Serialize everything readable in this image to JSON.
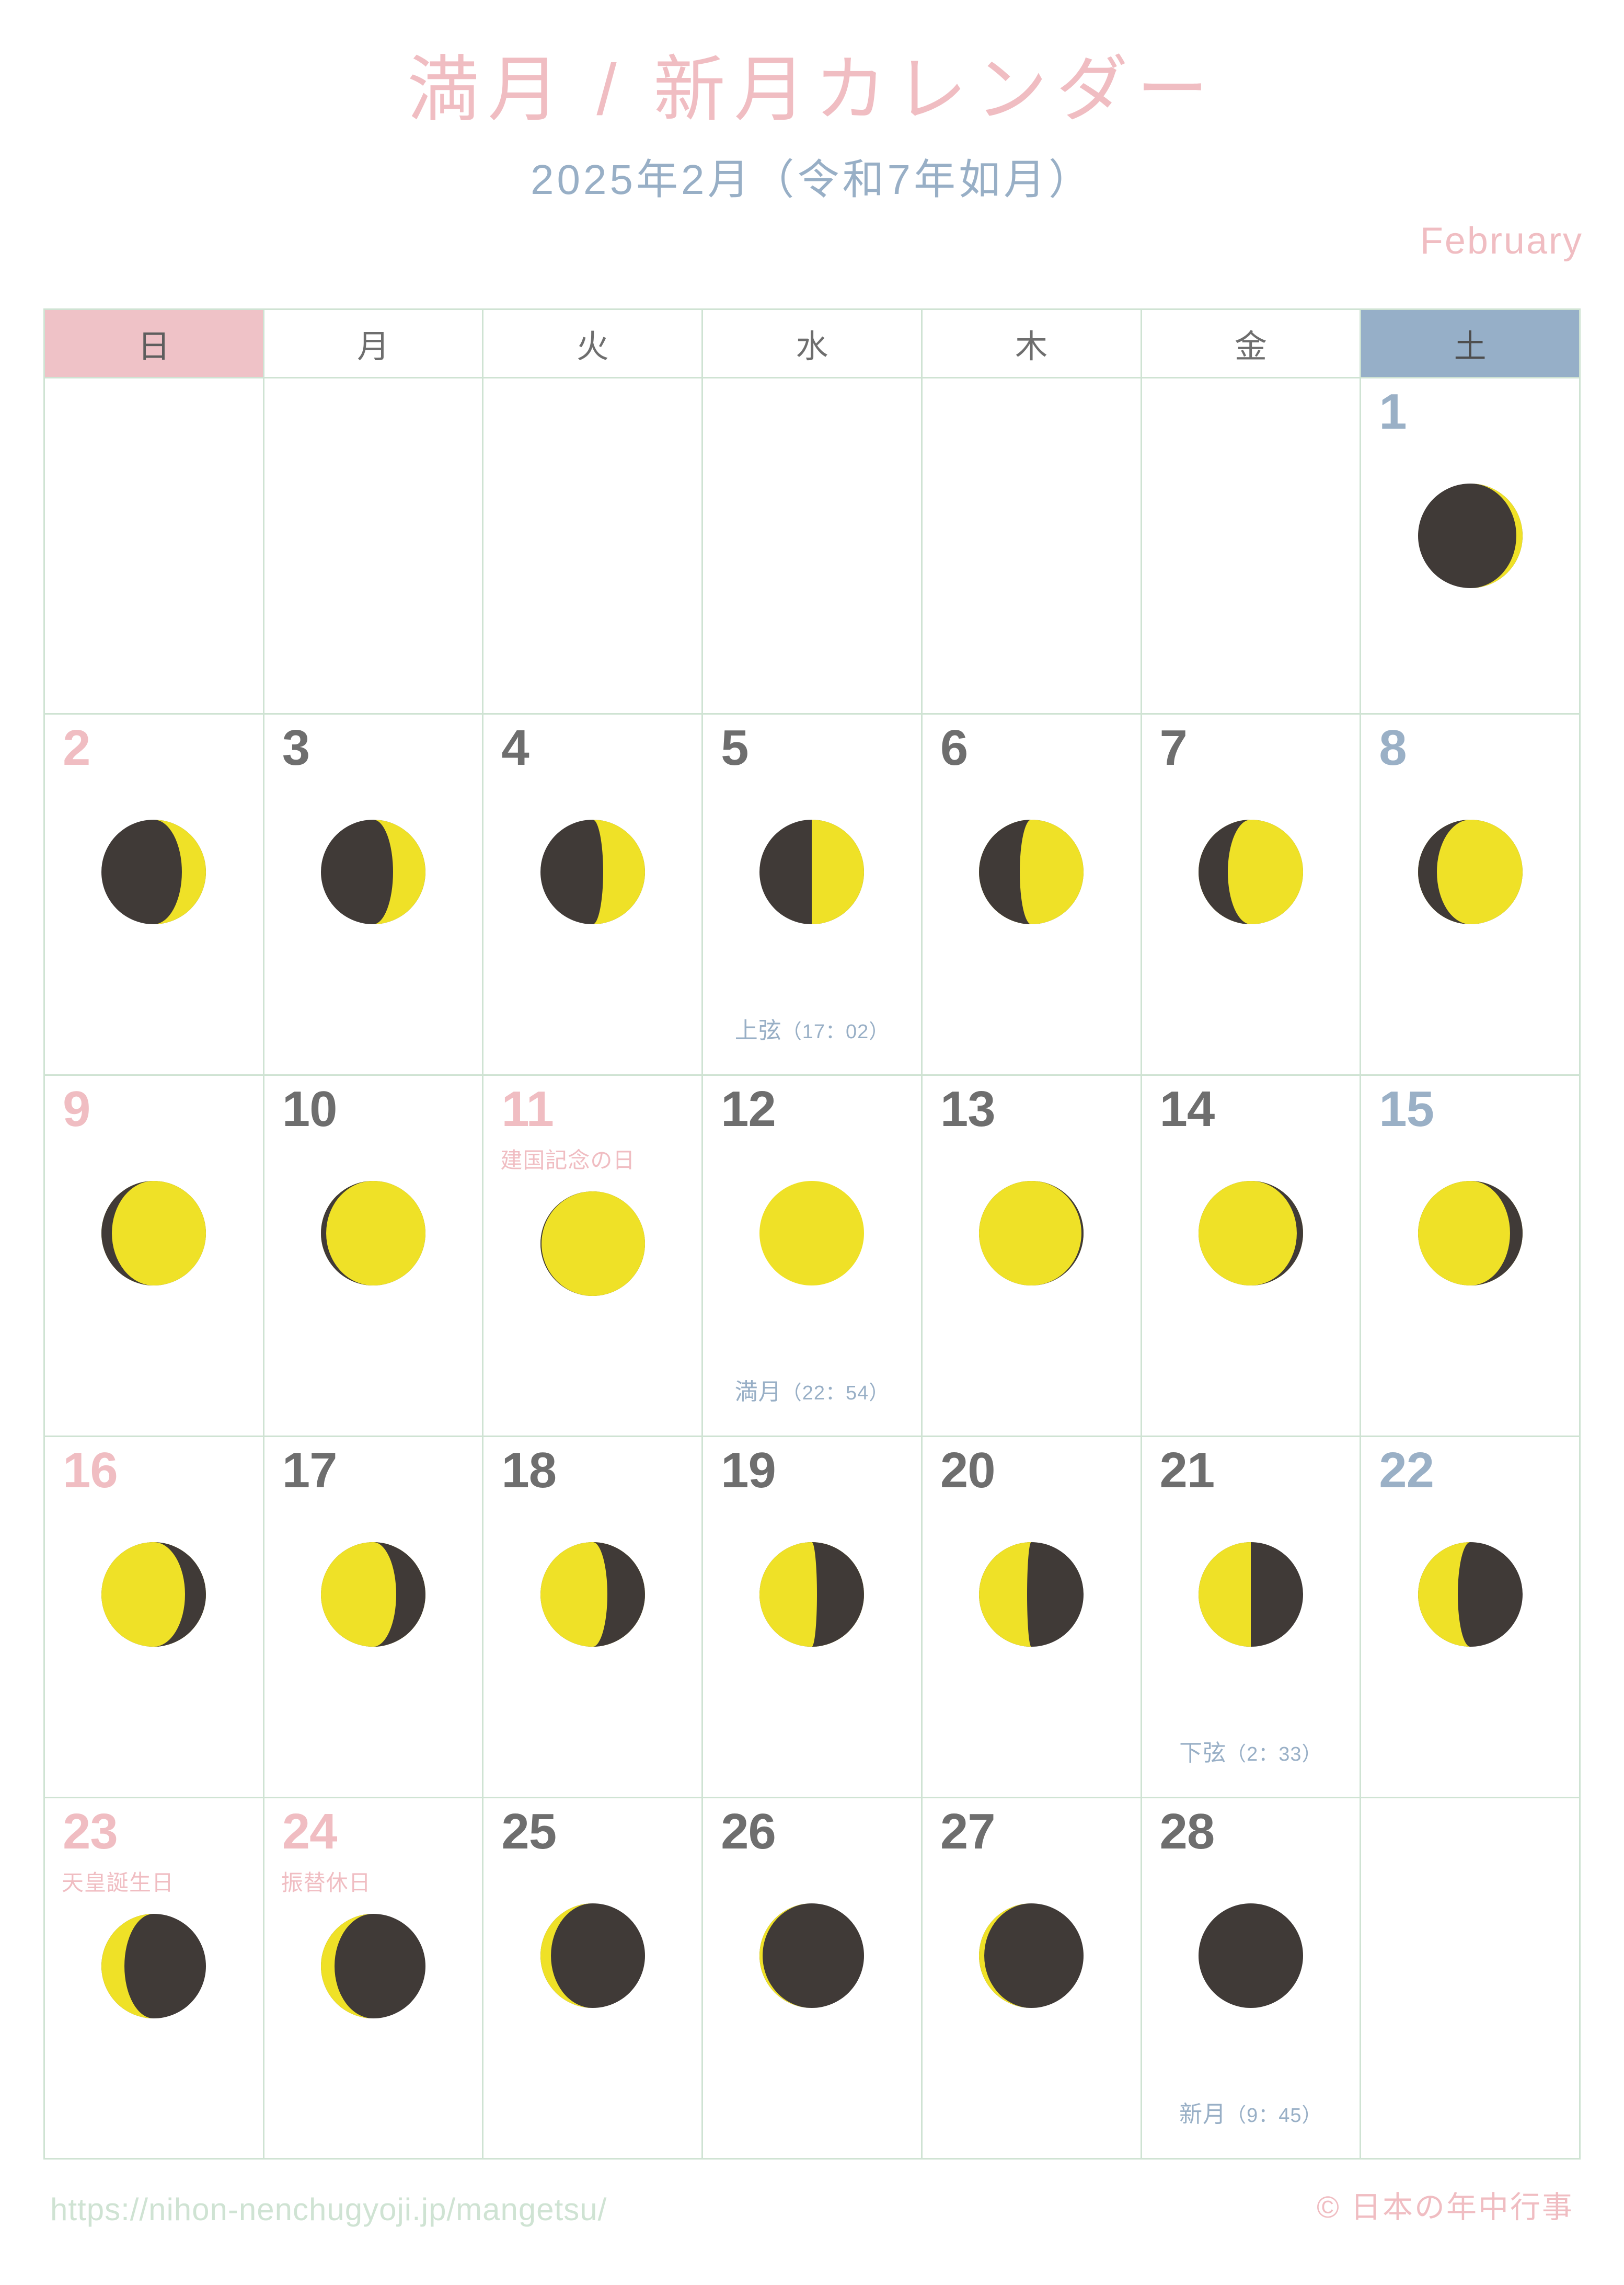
{
  "header": {
    "title": "満月 / 新月カレンダー",
    "subtitle": "2025年2月（令和7年如月）",
    "month_en": "February"
  },
  "weekdays": [
    {
      "label": "日",
      "kind": "sun"
    },
    {
      "label": "月",
      "kind": "weekday"
    },
    {
      "label": "火",
      "kind": "weekday"
    },
    {
      "label": "水",
      "kind": "weekday"
    },
    {
      "label": "木",
      "kind": "weekday"
    },
    {
      "label": "金",
      "kind": "weekday"
    },
    {
      "label": "土",
      "kind": "sat"
    }
  ],
  "colors": {
    "pink": "#F0BDC2",
    "blue": "#98AFC6",
    "grid_green": "#CFE3D3",
    "moon_dark": "#403A37",
    "moon_light": "#EFE127",
    "gray_text": "#6E6E6E"
  },
  "days": [
    {
      "n": "1",
      "col": 6,
      "kind": "sat",
      "illum": 0.06,
      "dir": "waxing",
      "holiday": "",
      "phase": "",
      "phase_time": ""
    },
    {
      "n": "2",
      "col": 0,
      "kind": "sun",
      "illum": 0.23,
      "dir": "waxing",
      "holiday": "",
      "phase": "",
      "phase_time": ""
    },
    {
      "n": "3",
      "col": 1,
      "kind": "weekday",
      "illum": 0.31,
      "dir": "waxing",
      "holiday": "",
      "phase": "",
      "phase_time": ""
    },
    {
      "n": "4",
      "col": 2,
      "kind": "weekday",
      "illum": 0.4,
      "dir": "waxing",
      "holiday": "",
      "phase": "",
      "phase_time": ""
    },
    {
      "n": "5",
      "col": 3,
      "kind": "weekday",
      "illum": 0.5,
      "dir": "waxing",
      "holiday": "",
      "phase": "上弦",
      "phase_time": "（17：02）"
    },
    {
      "n": "6",
      "col": 4,
      "kind": "weekday",
      "illum": 0.61,
      "dir": "waxing",
      "holiday": "",
      "phase": "",
      "phase_time": ""
    },
    {
      "n": "7",
      "col": 5,
      "kind": "weekday",
      "illum": 0.72,
      "dir": "waxing",
      "holiday": "",
      "phase": "",
      "phase_time": ""
    },
    {
      "n": "8",
      "col": 6,
      "kind": "sat",
      "illum": 0.82,
      "dir": "waxing",
      "holiday": "",
      "phase": "",
      "phase_time": ""
    },
    {
      "n": "9",
      "col": 0,
      "kind": "sun",
      "illum": 0.9,
      "dir": "waxing",
      "holiday": "",
      "phase": "",
      "phase_time": ""
    },
    {
      "n": "10",
      "col": 1,
      "kind": "weekday",
      "illum": 0.95,
      "dir": "waxing",
      "holiday": "",
      "phase": "",
      "phase_time": ""
    },
    {
      "n": "11",
      "col": 2,
      "kind": "holiday",
      "illum": 0.99,
      "dir": "waxing",
      "holiday": "建国記念の日",
      "phase": "",
      "phase_time": ""
    },
    {
      "n": "12",
      "col": 3,
      "kind": "weekday",
      "illum": 1.0,
      "dir": "full",
      "holiday": "",
      "phase": "満月",
      "phase_time": "（22：54）"
    },
    {
      "n": "13",
      "col": 4,
      "kind": "weekday",
      "illum": 0.98,
      "dir": "waning",
      "holiday": "",
      "phase": "",
      "phase_time": ""
    },
    {
      "n": "14",
      "col": 5,
      "kind": "weekday",
      "illum": 0.94,
      "dir": "waning",
      "holiday": "",
      "phase": "",
      "phase_time": ""
    },
    {
      "n": "15",
      "col": 6,
      "kind": "sat",
      "illum": 0.88,
      "dir": "waning",
      "holiday": "",
      "phase": "",
      "phase_time": ""
    },
    {
      "n": "16",
      "col": 0,
      "kind": "sun",
      "illum": 0.8,
      "dir": "waning",
      "holiday": "",
      "phase": "",
      "phase_time": ""
    },
    {
      "n": "17",
      "col": 1,
      "kind": "weekday",
      "illum": 0.72,
      "dir": "waning",
      "holiday": "",
      "phase": "",
      "phase_time": ""
    },
    {
      "n": "18",
      "col": 2,
      "kind": "weekday",
      "illum": 0.64,
      "dir": "waning",
      "holiday": "",
      "phase": "",
      "phase_time": ""
    },
    {
      "n": "19",
      "col": 3,
      "kind": "weekday",
      "illum": 0.55,
      "dir": "waning",
      "holiday": "",
      "phase": "",
      "phase_time": ""
    },
    {
      "n": "20",
      "col": 4,
      "kind": "weekday",
      "illum": 0.46,
      "dir": "waning",
      "holiday": "",
      "phase": "",
      "phase_time": ""
    },
    {
      "n": "21",
      "col": 5,
      "kind": "weekday",
      "illum": 0.5,
      "dir": "waning",
      "holiday": "",
      "phase": "下弦",
      "phase_time": "（2：33）"
    },
    {
      "n": "22",
      "col": 6,
      "kind": "sat",
      "illum": 0.38,
      "dir": "waning",
      "holiday": "",
      "phase": "",
      "phase_time": ""
    },
    {
      "n": "23",
      "col": 0,
      "kind": "holiday",
      "illum": 0.22,
      "dir": "waning",
      "holiday": "天皇誕生日",
      "phase": "",
      "phase_time": ""
    },
    {
      "n": "24",
      "col": 1,
      "kind": "holiday",
      "illum": 0.13,
      "dir": "waning",
      "holiday": "振替休日",
      "phase": "",
      "phase_time": ""
    },
    {
      "n": "25",
      "col": 2,
      "kind": "weekday",
      "illum": 0.1,
      "dir": "waning",
      "holiday": "",
      "phase": "",
      "phase_time": ""
    },
    {
      "n": "26",
      "col": 3,
      "kind": "weekday",
      "illum": 0.03,
      "dir": "waning",
      "holiday": "",
      "phase": "",
      "phase_time": ""
    },
    {
      "n": "27",
      "col": 4,
      "kind": "weekday",
      "illum": 0.05,
      "dir": "waning",
      "holiday": "",
      "phase": "",
      "phase_time": ""
    },
    {
      "n": "28",
      "col": 5,
      "kind": "weekday",
      "illum": 0.0,
      "dir": "new",
      "holiday": "",
      "phase": "新月",
      "phase_time": "（9：45）"
    }
  ],
  "footer": {
    "url": "https://nihon-nenchugyoji.jp/mangetsu/",
    "copyright": "© 日本の年中行事"
  }
}
